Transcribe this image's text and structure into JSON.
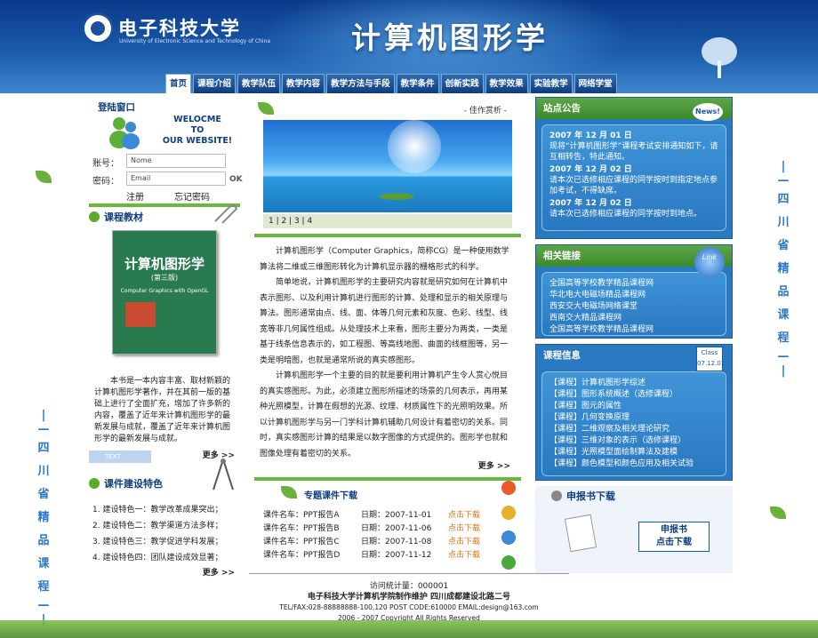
{
  "header": {
    "university_cn": "电子科技大学",
    "university_en": "University of Electronic Science and Technology of China",
    "site_title": "计算机图形学"
  },
  "nav": [
    "首页",
    "课程介绍",
    "教学队伍",
    "教学内容",
    "教学方法与手段",
    "教学条件",
    "创新实践",
    "教学效果",
    "实验教学",
    "网络学堂"
  ],
  "login": {
    "title": "登陆窗口",
    "welcome_line1": "WELOCME",
    "welcome_line2": "TO",
    "welcome_line3": "OUR WEBSITE!",
    "account_label": "账号：",
    "account_value": "Nome",
    "password_label": "密码：",
    "password_value": "Email",
    "ok": "OK",
    "register": "注册",
    "forgot": "忘记密码"
  },
  "textbook": {
    "title": "课程教材",
    "book_title": "计算机图形学",
    "book_edition": "(第三版)",
    "book_en": "Computer Graphics with OpenGL",
    "description": "本书是一本内容丰富、取材新颖的计算机图形学著作，并在其前一版的基础上进行了全面扩充，增加了许多新的内容，覆盖了近年来计算机图形学的最新发展与成就，覆盖了近年来计算机图形学的最新发展与成就。",
    "more": "更多 >>"
  },
  "features": {
    "tag": "TEXT",
    "title": "课件建设特色",
    "items": [
      "1. 建设特色一：教学改革成果突出；",
      "2. 建设特色二：教学渠道方法多样；",
      "3. 建设特色三：教学促进学科发展；",
      "4. 建设特色四：团队建设成效显著；"
    ],
    "more": "更多 >>"
  },
  "gallery": {
    "label": "- 佳作赏析 -",
    "pages": "1 | 2 | 3 | 4"
  },
  "intro": {
    "paragraphs": [
      "计算机图形学（Computer Graphics，简称CG）是一种使用数学算法将二维或三维图形转化为计算机显示器的栅格形式的科学。",
      "简单地说，计算机图形学的主要研究内容就是研究如何在计算机中表示图形、以及利用计算机进行图形的计算、处理和显示的相关原理与算法。图形通常由点、线、面、体等几何元素和灰度、色彩、线型、线宽等非几何属性组成。从处理技术上来看，图形主要分为两类，一类是基于线条信息表示的，如工程图、等高线地图、曲面的线框图等，另一类是明暗图，也就是通常所说的真实感图形。",
      "计算机图形学一个主要的目的就是要利用计算机产生令人赏心悦目的真实感图形。为此，必须建立图形所描述的场景的几何表示，再用某种光照模型，计算在假想的光源、纹理、材质属性下的光照明效果。所以计算机图形学与另一门学科计算机辅助几何设计有着密切的关系。同时，真实感图形计算的结果是以数字图像的方式提供的。图形学也就和图像处理有着密切的关系。"
    ],
    "more": "更多 >>"
  },
  "downloads": {
    "title": "专题课件下载",
    "rows": [
      {
        "name": "课件名车：PPT报告A",
        "date": "日期：2007-11-01",
        "action": "点击下载"
      },
      {
        "name": "课件名车：PPT报告B",
        "date": "日期：2007-11-06",
        "action": "点击下载"
      },
      {
        "name": "课件名车：PPT报告C",
        "date": "日期：2007-11-08",
        "action": "点击下载"
      },
      {
        "name": "课件名车：PPT报告D",
        "date": "日期：2007-11-12",
        "action": "点击下载"
      }
    ]
  },
  "notice": {
    "title": "站点公告",
    "badge": "News!",
    "items": [
      {
        "date": "2007 年 12 月 01 日",
        "text": "现将“计算机图形学”课程考试安排通知如下，请互相转告，特此通知。"
      },
      {
        "date": "2007 年 12 月 02 日",
        "text": "请本次已选修相应课程的同学按时到指定地点参加考试，不得缺席。"
      },
      {
        "date": "2007 年 12 月 02 日",
        "text": "请本次已选修相应课程的同学按时到地点。"
      }
    ]
  },
  "links": {
    "title": "相关链接",
    "badge": "Link",
    "items": [
      "全国高等学校教学精品课程网",
      "华北电大电磁场精品课程网",
      "西安交大电磁场网络课堂",
      "西南交大精品课程网",
      "全国高等学校教学精品课程网"
    ]
  },
  "courses": {
    "title": "课程信息",
    "badge": "Class",
    "badge_date": "07.12.01",
    "items": [
      "【课程】计算机图形学综述",
      "【课程】图形系统概述（选修课程）",
      "【课程】图元的属性",
      "【课程】几何变换原理",
      "【课程】二维观察及相关理论研究",
      "【课程】三维对象的表示（选修课程）",
      "【课程】光照模型面绘制算法及建模",
      "【课程】颜色模型和颜色应用及相关试验"
    ]
  },
  "apply": {
    "title": "申报书下载",
    "button_line1": "申报书",
    "button_line2": "点击下载"
  },
  "side_text": [
    "四",
    "川",
    "省",
    "精",
    "品",
    "课",
    "程"
  ],
  "footer": {
    "counter": "访问统计量：000001",
    "line1": "电子科技大学计算机学院制作维护 四川成都建设北路二号",
    "line2": "TEL/FAX:028-88888888-100,120  POST CODE:610000  EMAIL:design@163.com",
    "line3": "2006 - 2007 Copyright All Rights Reserved"
  },
  "colors": {
    "header": "#0a3a8a",
    "accent_green": "#6cb83c",
    "panel_blue": "#2a78c0",
    "download_orange": "#e07010"
  }
}
